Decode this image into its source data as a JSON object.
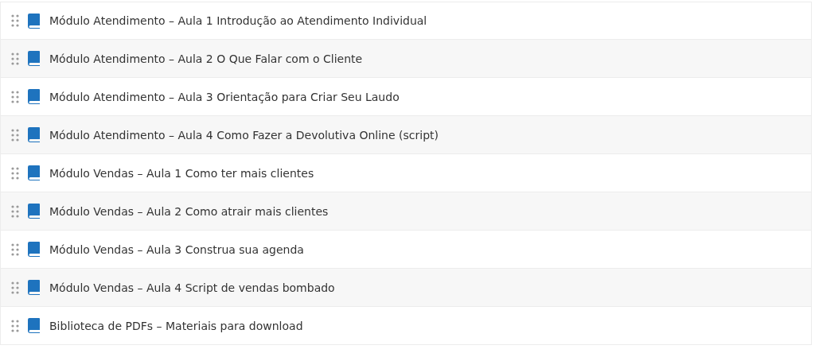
{
  "lessons": [
    {
      "title": "Módulo Atendimento – Aula 1 Introdução ao Atendimento Individual"
    },
    {
      "title": "Módulo Atendimento – Aula 2 O Que Falar com o Cliente"
    },
    {
      "title": "Módulo Atendimento – Aula 3 Orientação para Criar Seu Laudo"
    },
    {
      "title": "Módulo Atendimento – Aula 4 Como Fazer a Devolutiva Online (script)"
    },
    {
      "title": "Módulo Vendas – Aula 1 Como ter mais clientes"
    },
    {
      "title": "Módulo Vendas – Aula 2 Como atrair mais clientes"
    },
    {
      "title": "Módulo Vendas – Aula 3 Construa sua agenda"
    },
    {
      "title": "Módulo Vendas – Aula 4 Script de vendas bombado"
    },
    {
      "title": "Biblioteca de PDFs – Materiais para download"
    }
  ]
}
